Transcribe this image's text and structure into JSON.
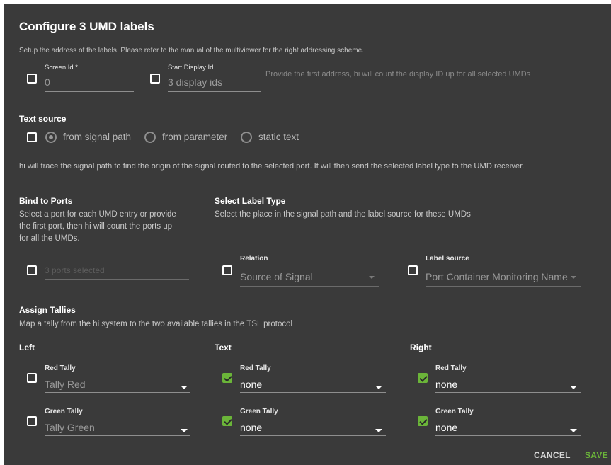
{
  "dialog": {
    "title": "Configure 3 UMD labels",
    "setup_desc": "Setup the address of the labels. Please refer to the manual of the multiviewer for the right addressing scheme."
  },
  "address": {
    "screen_id": {
      "label": "Screen Id *",
      "value": "0",
      "checked": false
    },
    "start_display_id": {
      "label": "Start Display Id",
      "value": "3 display ids",
      "checked": false
    },
    "hint": "Provide the first address, hi will count the display ID up for all selected UMDs"
  },
  "text_source": {
    "title": "Text source",
    "checked": false,
    "options": [
      "from signal path",
      "from parameter",
      "static text"
    ],
    "selected": "from signal path",
    "desc": "hi will trace the signal path to find the origin of the signal routed to the selected port. It will then send the selected label type to the UMD receiver."
  },
  "bind_ports": {
    "title": "Bind to Ports",
    "desc_lines": [
      "Select a port for each UMD entry or provide",
      "the first port, then hi will count the ports up",
      "for all the UMDs."
    ],
    "value": "3 ports selected",
    "checked": false
  },
  "label_type": {
    "title": "Select Label Type",
    "desc": "Select the place in the signal path and the label source for these UMDs",
    "relation": {
      "label": "Relation",
      "value": "Source of Signal",
      "checked": false
    },
    "label_source": {
      "label": "Label source",
      "value": "Port Container Monitoring Name",
      "checked": false
    }
  },
  "tallies": {
    "title": "Assign Tallies",
    "desc": "Map a tally from the hi system to the two available tallies in the TSL protocol",
    "columns": [
      {
        "heading": "Left",
        "red": {
          "label": "Red Tally",
          "value": "Tally Red",
          "checked": false
        },
        "green": {
          "label": "Green Tally",
          "value": "Tally Green",
          "checked": false
        }
      },
      {
        "heading": "Text",
        "red": {
          "label": "Red Tally",
          "value": "none",
          "checked": true
        },
        "green": {
          "label": "Green Tally",
          "value": "none",
          "checked": true
        }
      },
      {
        "heading": "Right",
        "red": {
          "label": "Red Tally",
          "value": "none",
          "checked": true
        },
        "green": {
          "label": "Green Tally",
          "value": "none",
          "checked": true
        }
      }
    ]
  },
  "actions": {
    "cancel": "CANCEL",
    "save": "SAVE"
  },
  "colors": {
    "background": "#3a3a3a",
    "accent": "#6bb539",
    "save": "#6bb539"
  }
}
